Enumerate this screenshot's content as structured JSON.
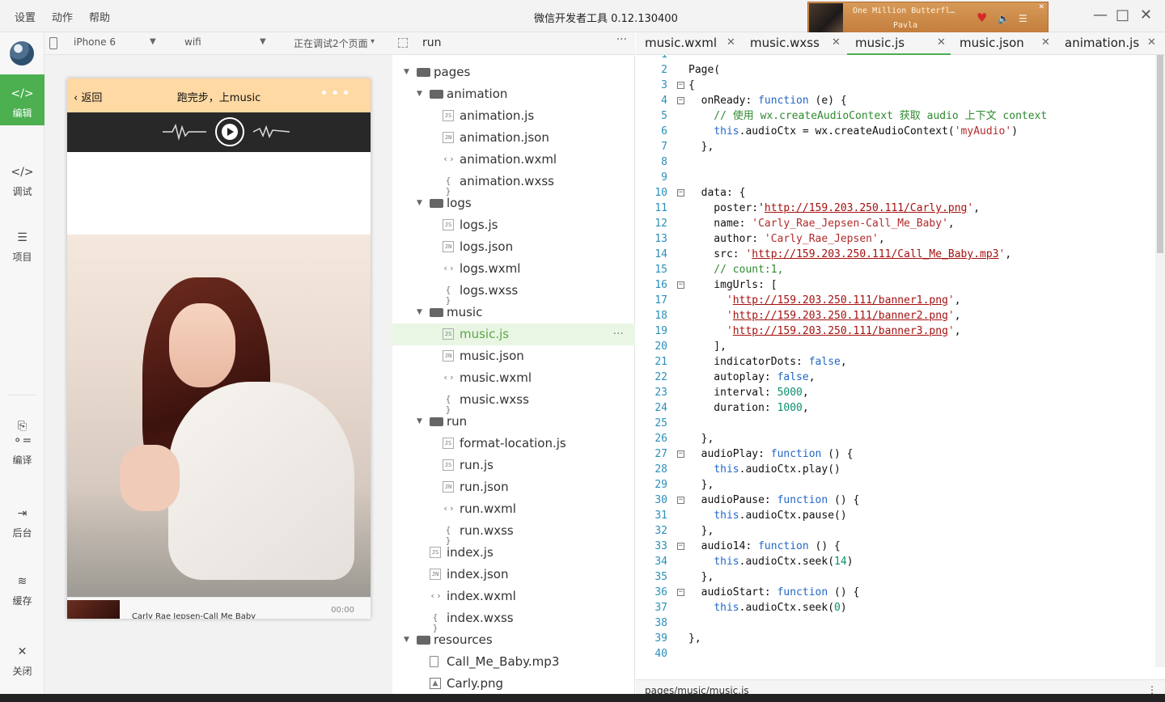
{
  "titlebar": {
    "menus": [
      "设置",
      "动作",
      "帮助"
    ],
    "title": "微信开发者工具 0.12.130400",
    "music_player": {
      "song": "One Million Butterfl…",
      "artist": "Pavla"
    }
  },
  "sidebar": {
    "items": [
      {
        "label": "编辑",
        "icon": "code-icon",
        "active": true
      },
      {
        "label": "调试",
        "icon": "debug-icon"
      },
      {
        "label": "项目",
        "icon": "menu-icon"
      },
      {
        "label": "编译",
        "icon": "compile-icon"
      },
      {
        "label": "后台",
        "icon": "background-icon"
      },
      {
        "label": "缓存",
        "icon": "layers-icon"
      },
      {
        "label": "关闭",
        "icon": "close-icon"
      }
    ]
  },
  "device": {
    "model": "iPhone 6",
    "network": "wifi",
    "debug_status": "正在调试2个页面"
  },
  "phone": {
    "nav_back": "返回",
    "nav_title": "跑完步，上music",
    "song_name": "Carly Rae Jepsen-Call Me Baby",
    "time": "00:00"
  },
  "file_tree": {
    "project": "run",
    "items": [
      {
        "name": "pages",
        "type": "folder",
        "level": 0
      },
      {
        "name": "animation",
        "type": "folder",
        "level": 1
      },
      {
        "name": "animation.js",
        "type": "js",
        "level": 2
      },
      {
        "name": "animation.json",
        "type": "json",
        "level": 2
      },
      {
        "name": "animation.wxml",
        "type": "wxml",
        "level": 2
      },
      {
        "name": "animation.wxss",
        "type": "wxss",
        "level": 2
      },
      {
        "name": "logs",
        "type": "folder",
        "level": 1
      },
      {
        "name": "logs.js",
        "type": "js",
        "level": 2
      },
      {
        "name": "logs.json",
        "type": "json",
        "level": 2
      },
      {
        "name": "logs.wxml",
        "type": "wxml",
        "level": 2
      },
      {
        "name": "logs.wxss",
        "type": "wxss",
        "level": 2
      },
      {
        "name": "music",
        "type": "folder",
        "level": 1
      },
      {
        "name": "music.js",
        "type": "js",
        "level": 2,
        "selected": true
      },
      {
        "name": "music.json",
        "type": "json",
        "level": 2
      },
      {
        "name": "music.wxml",
        "type": "wxml",
        "level": 2
      },
      {
        "name": "music.wxss",
        "type": "wxss",
        "level": 2
      },
      {
        "name": "run",
        "type": "folder",
        "level": 1
      },
      {
        "name": "format-location.js",
        "type": "js",
        "level": 2
      },
      {
        "name": "run.js",
        "type": "js",
        "level": 2
      },
      {
        "name": "run.json",
        "type": "json",
        "level": 2
      },
      {
        "name": "run.wxml",
        "type": "wxml",
        "level": 2
      },
      {
        "name": "run.wxss",
        "type": "wxss",
        "level": 2
      },
      {
        "name": "index.js",
        "type": "js",
        "level": 1
      },
      {
        "name": "index.json",
        "type": "json",
        "level": 1
      },
      {
        "name": "index.wxml",
        "type": "wxml",
        "level": 1
      },
      {
        "name": "index.wxss",
        "type": "wxss",
        "level": 1
      },
      {
        "name": "resources",
        "type": "folder",
        "level": 0
      },
      {
        "name": "Call_Me_Baby.mp3",
        "type": "file",
        "level": 1
      },
      {
        "name": "Carly.png",
        "type": "image",
        "level": 1
      }
    ]
  },
  "editor": {
    "tabs": [
      "music.wxml",
      "music.wxss",
      "music.js",
      "music.json",
      "animation.js"
    ],
    "active_tab": "music.js",
    "file_path": "pages/music/music.js",
    "lines": [
      {
        "n": 1,
        "parts": []
      },
      {
        "n": 2,
        "parts": [
          {
            "t": "Page("
          }
        ]
      },
      {
        "n": 3,
        "fold": true,
        "parts": [
          {
            "t": "{"
          }
        ]
      },
      {
        "n": 4,
        "fold": true,
        "parts": [
          {
            "t": "  onReady: "
          },
          {
            "c": "kw",
            "t": "function"
          },
          {
            "t": " (e) {"
          }
        ]
      },
      {
        "n": 5,
        "parts": [
          {
            "c": "cmt",
            "t": "    // 使用 wx.createAudioContext 获取 audio 上下文 context"
          }
        ]
      },
      {
        "n": 6,
        "parts": [
          {
            "t": "    "
          },
          {
            "c": "kw",
            "t": "this"
          },
          {
            "t": ".audioCtx = wx.createAudioContext("
          },
          {
            "c": "str",
            "t": "'myAudio'"
          },
          {
            "t": ")"
          }
        ]
      },
      {
        "n": 7,
        "parts": [
          {
            "t": "  },"
          }
        ]
      },
      {
        "n": 8,
        "parts": []
      },
      {
        "n": 9,
        "parts": []
      },
      {
        "n": 10,
        "fold": true,
        "parts": [
          {
            "t": "  data: {"
          }
        ]
      },
      {
        "n": 11,
        "parts": [
          {
            "t": "    poster:'"
          },
          {
            "c": "lnk",
            "t": "http://159.203.250.111/Carly.png"
          },
          {
            "c": "str",
            "t": "'"
          },
          {
            "t": ","
          }
        ]
      },
      {
        "n": 12,
        "parts": [
          {
            "t": "    name: "
          },
          {
            "c": "str",
            "t": "'Carly_Rae_Jepsen-Call_Me_Baby'"
          },
          {
            "t": ","
          }
        ]
      },
      {
        "n": 13,
        "parts": [
          {
            "t": "    author: "
          },
          {
            "c": "str",
            "t": "'Carly_Rae_Jepsen'"
          },
          {
            "t": ","
          }
        ]
      },
      {
        "n": 14,
        "parts": [
          {
            "t": "    src: "
          },
          {
            "c": "str",
            "t": "'"
          },
          {
            "c": "lnk",
            "t": "http://159.203.250.111/Call_Me_Baby.mp3"
          },
          {
            "c": "str",
            "t": "'"
          },
          {
            "t": ","
          }
        ]
      },
      {
        "n": 15,
        "parts": [
          {
            "c": "cmt",
            "t": "    // count:1,"
          }
        ]
      },
      {
        "n": 16,
        "fold": true,
        "parts": [
          {
            "t": "    imgUrls: ["
          }
        ]
      },
      {
        "n": 17,
        "parts": [
          {
            "t": "      "
          },
          {
            "c": "str",
            "t": "'"
          },
          {
            "c": "lnk",
            "t": "http://159.203.250.111/banner1.png"
          },
          {
            "c": "str",
            "t": "'"
          },
          {
            "t": ","
          }
        ]
      },
      {
        "n": 18,
        "parts": [
          {
            "t": "      "
          },
          {
            "c": "str",
            "t": "'"
          },
          {
            "c": "lnk",
            "t": "http://159.203.250.111/banner2.png"
          },
          {
            "c": "str",
            "t": "'"
          },
          {
            "t": ","
          }
        ]
      },
      {
        "n": 19,
        "parts": [
          {
            "t": "      "
          },
          {
            "c": "str",
            "t": "'"
          },
          {
            "c": "lnk",
            "t": "http://159.203.250.111/banner3.png"
          },
          {
            "c": "str",
            "t": "'"
          },
          {
            "t": ","
          }
        ]
      },
      {
        "n": 20,
        "parts": [
          {
            "t": "    ],"
          }
        ]
      },
      {
        "n": 21,
        "parts": [
          {
            "t": "    indicatorDots: "
          },
          {
            "c": "kw",
            "t": "false"
          },
          {
            "t": ","
          }
        ]
      },
      {
        "n": 22,
        "parts": [
          {
            "t": "    autoplay: "
          },
          {
            "c": "kw",
            "t": "false"
          },
          {
            "t": ","
          }
        ]
      },
      {
        "n": 23,
        "parts": [
          {
            "t": "    interval: "
          },
          {
            "c": "num",
            "t": "5000"
          },
          {
            "t": ","
          }
        ]
      },
      {
        "n": 24,
        "parts": [
          {
            "t": "    duration: "
          },
          {
            "c": "num",
            "t": "1000"
          },
          {
            "t": ","
          }
        ]
      },
      {
        "n": 25,
        "parts": []
      },
      {
        "n": 26,
        "parts": [
          {
            "t": "  },"
          }
        ]
      },
      {
        "n": 27,
        "fold": true,
        "parts": [
          {
            "t": "  audioPlay: "
          },
          {
            "c": "kw",
            "t": "function"
          },
          {
            "t": " () {"
          }
        ]
      },
      {
        "n": 28,
        "parts": [
          {
            "t": "    "
          },
          {
            "c": "kw",
            "t": "this"
          },
          {
            "t": ".audioCtx.play()"
          }
        ]
      },
      {
        "n": 29,
        "parts": [
          {
            "t": "  },"
          }
        ]
      },
      {
        "n": 30,
        "fold": true,
        "parts": [
          {
            "t": "  audioPause: "
          },
          {
            "c": "kw",
            "t": "function"
          },
          {
            "t": " () {"
          }
        ]
      },
      {
        "n": 31,
        "parts": [
          {
            "t": "    "
          },
          {
            "c": "kw",
            "t": "this"
          },
          {
            "t": ".audioCtx.pause()"
          }
        ]
      },
      {
        "n": 32,
        "parts": [
          {
            "t": "  },"
          }
        ]
      },
      {
        "n": 33,
        "fold": true,
        "parts": [
          {
            "t": "  audio14: "
          },
          {
            "c": "kw",
            "t": "function"
          },
          {
            "t": " () {"
          }
        ]
      },
      {
        "n": 34,
        "parts": [
          {
            "t": "    "
          },
          {
            "c": "kw",
            "t": "this"
          },
          {
            "t": ".audioCtx.seek("
          },
          {
            "c": "num",
            "t": "14"
          },
          {
            "t": ")"
          }
        ]
      },
      {
        "n": 35,
        "parts": [
          {
            "t": "  },"
          }
        ]
      },
      {
        "n": 36,
        "fold": true,
        "parts": [
          {
            "t": "  audioStart: "
          },
          {
            "c": "kw",
            "t": "function"
          },
          {
            "t": " () {"
          }
        ]
      },
      {
        "n": 37,
        "parts": [
          {
            "t": "    "
          },
          {
            "c": "kw",
            "t": "this"
          },
          {
            "t": ".audioCtx.seek("
          },
          {
            "c": "num",
            "t": "0"
          },
          {
            "t": ")"
          }
        ]
      },
      {
        "n": 38,
        "parts": []
      },
      {
        "n": 39,
        "parts": [
          {
            "t": "},"
          }
        ]
      },
      {
        "n": 40,
        "parts": []
      }
    ]
  },
  "colors": {
    "accent": "#4caf50",
    "keyword": "#2367c6",
    "string": "#b12b2b",
    "comment": "#2e8a2e",
    "number": "#0a8f6f"
  }
}
